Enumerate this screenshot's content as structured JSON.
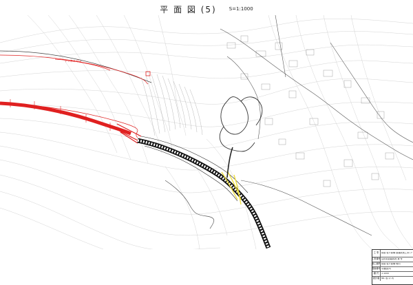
{
  "sheet": {
    "title": "平 面 図 (5)",
    "scale": "S=1:1000"
  },
  "titleblock": {
    "rows": [
      {
        "key": "工 事",
        "value": "県道 松ヶ原線 道路改良工事 (トンネル)"
      },
      {
        "key": "工事番号",
        "value": "山形県道路改良 第 号"
      },
      {
        "key": "施工箇所",
        "value": "県道 松ヶ原線 地内"
      },
      {
        "key": "図面番号",
        "value": "平面図(5)"
      },
      {
        "key": "縮 尺",
        "value": "1:1000"
      },
      {
        "key": "設計者",
        "value": "No.  枚 の 内"
      }
    ]
  },
  "colors": {
    "contour": "#c8c8c8",
    "road": "#222222",
    "tunnel": "#e02020",
    "survey": "#444444",
    "highlight": "#f0e040"
  }
}
